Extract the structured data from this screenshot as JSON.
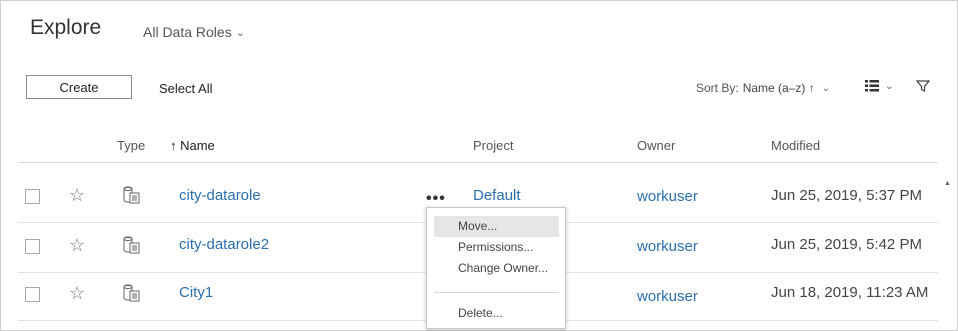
{
  "header": {
    "title": "Explore",
    "roles_selector": "All Data Roles"
  },
  "toolbar": {
    "create_label": "Create",
    "select_all_label": "Select All",
    "sort_prefix": "Sort By:",
    "sort_value": "Name (a–z) ↑"
  },
  "columns": {
    "type": "Type",
    "name": "↑ Name",
    "project": "Project",
    "owner": "Owner",
    "modified": "Modified"
  },
  "rows": [
    {
      "name": "city-datarole",
      "project": "Default",
      "owner": "workuser",
      "modified": "Jun 25, 2019, 5:37 PM"
    },
    {
      "name": "city-datarole2",
      "project": "",
      "owner": "workuser",
      "modified": "Jun 25, 2019, 5:42 PM"
    },
    {
      "name": "City1",
      "project": "",
      "owner": "workuser",
      "modified": "Jun 18, 2019, 11:23 AM"
    }
  ],
  "row_actions_label": "•••",
  "context_menu": {
    "items": [
      "Move...",
      "Permissions...",
      "Change Owner...",
      "Delete..."
    ],
    "highlighted": "Move..."
  },
  "colors": {
    "link": "#2a6fb0",
    "menu_highlight": "#e6e6e6"
  }
}
